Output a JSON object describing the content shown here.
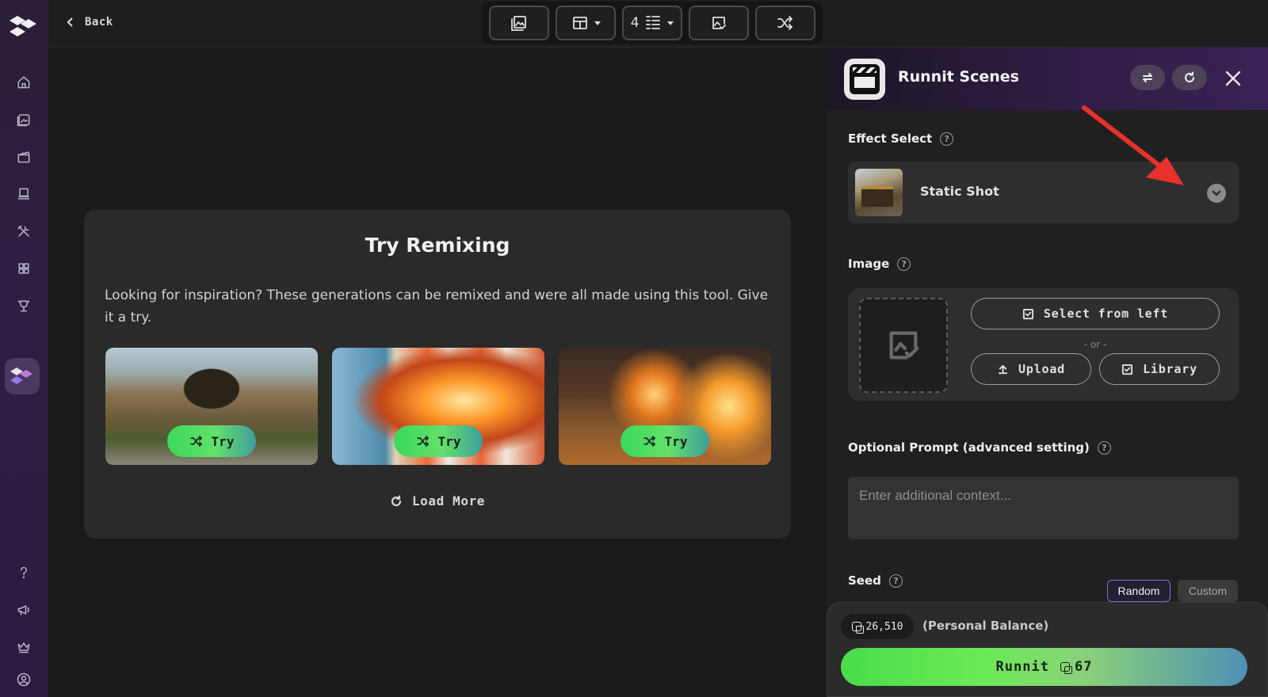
{
  "topbar": {
    "back_label": "Back",
    "count_label": "4"
  },
  "sidebar": {
    "items": [
      "home-icon",
      "gallery-icon",
      "scenes-icon",
      "queue-icon",
      "tools-icon",
      "apps-icon",
      "trophy-icon",
      "runnit-app-icon"
    ],
    "bottom_items": [
      "help-icon",
      "megaphone-icon",
      "crown-icon",
      "account-icon"
    ]
  },
  "remix": {
    "title": "Try Remixing",
    "description": "Looking for inspiration? These generations can be remixed and were all made using this tool. Give it a try.",
    "cards": [
      {
        "try_label": "Try"
      },
      {
        "try_label": "Try"
      },
      {
        "try_label": "Try"
      }
    ],
    "load_more_label": "Load More"
  },
  "panel": {
    "title": "Runnit Scenes",
    "effect_label": "Effect Select",
    "effect_value": "Static Shot",
    "image_label": "Image",
    "select_from_left_label": "Select from left",
    "or_label": "- or -",
    "upload_label": "Upload",
    "library_label": "Library",
    "prompt_label": "Optional Prompt (advanced setting)",
    "prompt_placeholder": "Enter additional context...",
    "seed_label": "Seed",
    "seed_random_label": "Random",
    "seed_custom_label": "Custom"
  },
  "footer": {
    "balance_value": "26,510",
    "balance_label": "(Personal Balance)",
    "runnit_label": "Runnit",
    "cost_value": "67"
  },
  "colors": {
    "accent_green": "#48dd4a",
    "accent_purple": "#8a6bd6",
    "annotation_red": "#e8312a"
  }
}
